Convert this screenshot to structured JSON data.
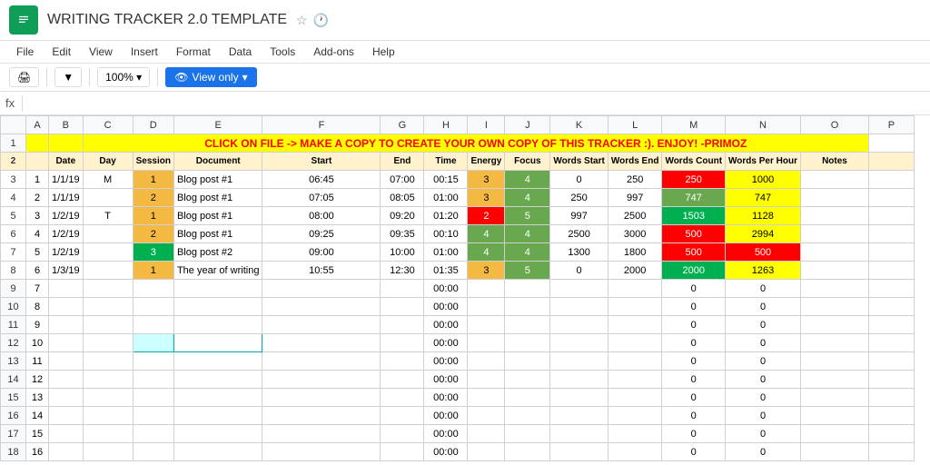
{
  "app": {
    "icon": "sheets-icon",
    "title": "WRITING TRACKER 2.0 TEMPLATE",
    "star_icon": "☆",
    "history_icon": "🕐"
  },
  "menu": {
    "items": [
      "File",
      "Edit",
      "View",
      "Insert",
      "Format",
      "Data",
      "Tools",
      "Add-ons",
      "Help"
    ]
  },
  "toolbar": {
    "print_icon": "🖨",
    "filter_icon": "▼",
    "zoom": "100%",
    "view_only_label": "View only",
    "dropdown_icon": "▾"
  },
  "formula_bar": {
    "cell_ref": "fx"
  },
  "banner": {
    "text": "CLICK ON FILE -> MAKE A COPY TO CREATE YOUR OWN COPY OF THIS TRACKER :). ENJOY! -PRIMOZ"
  },
  "headers": {
    "row2": [
      "",
      "Date",
      "Day",
      "Session",
      "Document",
      "Start",
      "End",
      "Time",
      "Energy",
      "Focus",
      "Words Start",
      "Words End",
      "Words Count",
      "Words Per Hour",
      "Notes"
    ]
  },
  "columns": [
    "",
    "A",
    "B",
    "C",
    "D",
    "E",
    "F",
    "G",
    "H",
    "I",
    "J",
    "K",
    "L",
    "M",
    "N",
    "O"
  ],
  "rows": [
    {
      "num": 3,
      "b": "1",
      "c": "1/1/19",
      "d": "M",
      "e": "1",
      "e_color": "orange",
      "f": "Blog post #1",
      "g": "06:45",
      "h": "07:00",
      "i": "00:15",
      "j": "3",
      "j_color": "orange",
      "k": "4",
      "k_color": "green",
      "l": "0",
      "m": "250",
      "n": "250",
      "n_color": "red",
      "o": "1000",
      "o_color": "yellow"
    },
    {
      "num": 4,
      "b": "2",
      "c": "1/1/19",
      "d": "",
      "e": "2",
      "e_color": "orange",
      "f": "Blog post #1",
      "g": "07:05",
      "h": "08:05",
      "i": "01:00",
      "j": "3",
      "j_color": "orange",
      "k": "4",
      "k_color": "green",
      "l": "250",
      "m": "997",
      "n": "747",
      "n_color": "green",
      "o": "747",
      "o_color": "yellow"
    },
    {
      "num": 5,
      "b": "3",
      "c": "1/2/19",
      "d": "T",
      "e": "1",
      "e_color": "orange",
      "f": "Blog post #1",
      "g": "08:00",
      "h": "09:20",
      "i": "01:20",
      "j": "2",
      "j_color": "red",
      "k": "5",
      "k_color": "green",
      "l": "997",
      "m": "2500",
      "n": "1503",
      "n_color": "green",
      "o": "1128",
      "o_color": "yellow"
    },
    {
      "num": 6,
      "b": "4",
      "c": "1/2/19",
      "d": "",
      "e": "2",
      "e_color": "orange",
      "f": "Blog post #1",
      "g": "09:25",
      "h": "09:35",
      "i": "00:10",
      "j": "4",
      "j_color": "green",
      "k": "4",
      "k_color": "green",
      "l": "2500",
      "m": "3000",
      "n": "500",
      "n_color": "red",
      "o": "2994",
      "o_color": "yellow"
    },
    {
      "num": 7,
      "b": "5",
      "c": "1/2/19",
      "d": "",
      "e": "3",
      "e_color": "light-green",
      "f": "Blog post #2",
      "g": "09:00",
      "h": "10:00",
      "i": "01:00",
      "j": "4",
      "j_color": "green",
      "k": "4",
      "k_color": "green",
      "l": "1300",
      "m": "1800",
      "n": "500",
      "n_color": "red",
      "o": "500",
      "o_color": "red"
    },
    {
      "num": 8,
      "b": "6",
      "c": "1/3/19",
      "d": "",
      "e": "1",
      "e_color": "orange",
      "f": "The year of writing",
      "g": "10:55",
      "h": "12:30",
      "i": "01:35",
      "j": "3",
      "j_color": "orange",
      "k": "5",
      "k_color": "green",
      "l": "0",
      "m": "2000",
      "n": "2000",
      "n_color": "green",
      "o": "1263",
      "o_color": "yellow"
    }
  ],
  "empty_rows": [
    {
      "num": 9,
      "b": "7"
    },
    {
      "num": 10,
      "b": "8"
    },
    {
      "num": 11,
      "b": "9"
    },
    {
      "num": 12,
      "b": "10"
    },
    {
      "num": 13,
      "b": "11"
    },
    {
      "num": 14,
      "b": "12"
    },
    {
      "num": 15,
      "b": "13"
    },
    {
      "num": 16,
      "b": "14"
    },
    {
      "num": 17,
      "b": "15"
    },
    {
      "num": 18,
      "b": "16"
    }
  ],
  "colors": {
    "orange": "#f4b942",
    "green": "#6aa84f",
    "light_green": "#93c47d",
    "red": "#ff0000",
    "yellow": "#ffff00",
    "banner_bg": "#ffff00",
    "banner_text": "#ff0000",
    "header_bg": "#fff2cc"
  }
}
